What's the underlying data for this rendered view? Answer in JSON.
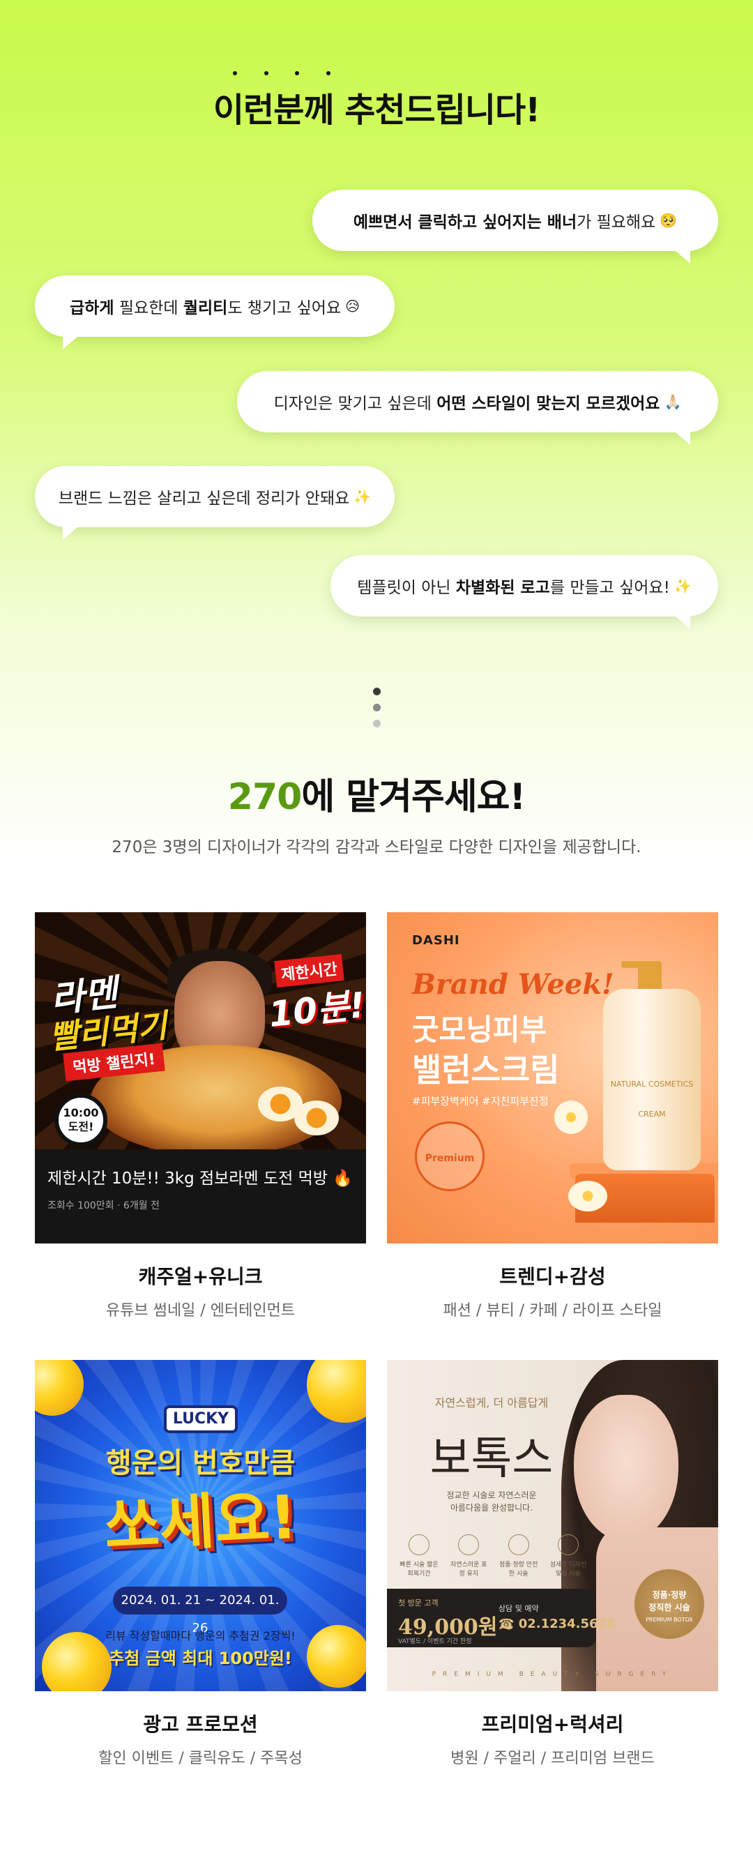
{
  "header": {
    "dots": [
      "•",
      "•",
      "•",
      "•"
    ],
    "title": "이런분께 추천드립니다!"
  },
  "bubbles": [
    {
      "pre": "",
      "bold": "예쁘면서 클릭하고 싶어지는 배너",
      "post": "가 필요해요",
      "emoji": "🥺"
    },
    {
      "pre": "",
      "bold": "급하게",
      "mid": " 필요한데 ",
      "bold2": "퀄리티",
      "post": "도 챙기고 싶어요",
      "emoji": "😥"
    },
    {
      "pre": "디자인은 맞기고 싶은데 ",
      "bold": "어떤 스타일이 맞는지 모르겠어요",
      "post": "",
      "emoji": "🙏🏻"
    },
    {
      "pre": "브랜드 느낌은 살리고 싶은데 정리가 안돼요",
      "bold": "",
      "post": "",
      "emoji": "✨"
    },
    {
      "pre": "템플릿이 아닌 ",
      "bold": "차별화된 로고",
      "post": "를 만들고 싶어요!",
      "emoji": "✨"
    }
  ],
  "section2": {
    "title_accent": "270",
    "title_rest": "에 맡겨주세요!",
    "subtitle": "270은 3명의 디자이너가 각각의 감각과 스타일로 다양한 디자인을 제공합니다."
  },
  "cards": [
    {
      "title": "캐주얼+유니크",
      "desc": "유튜브 썸네일 / 엔터테인먼트",
      "art": {
        "t1": "라멘",
        "t2": "빨리먹기",
        "t3": "먹방 챌린지!",
        "badge_top": "제한시간",
        "badge_big": "10분!",
        "clock": "10:00",
        "clock2": "도전!",
        "caption": "제한시간 10분!! 3kg 점보라멘 도전 먹방 🔥",
        "meta": "조회수 100만회 · 6개월 전"
      }
    },
    {
      "title": "트렌디+감성",
      "desc": "패션 / 뷰티 / 카페 / 라이프 스타일",
      "art": {
        "brand": "DASHI",
        "bw": "Brand Week!",
        "l1": "굿모닝피부",
        "l2": "밸런스크림",
        "tags": "#피부장벽케어 #지친피부진정",
        "seal": "Premium",
        "bottle": "NATURAL COSMETICS",
        "bottle2": "CREAM"
      }
    },
    {
      "title": "광고 프로모션",
      "desc": "할인 이벤트 / 클릭유도 / 주목성",
      "art": {
        "lucky": "LUCKY",
        "t1": "행운의 번호만큼",
        "t2": "쏘세요!",
        "date": "2024. 01. 21 ~ 2024. 01. 26",
        "n1": "리뷰 작성할때마다 행운의 추첨권 2장씩!",
        "n2": "추첨 금액 최대 100만원!"
      }
    },
    {
      "title": "프리미엄+럭셔리",
      "desc": "병원 / 주얼리 / 프리미엄 브랜드",
      "art": {
        "sub": "자연스럽게, 더 아름답게",
        "big": "보톡스",
        "d1": "정교한 시술로 자연스러운",
        "d2": "아름다움을 완성합니다.",
        "icons": [
          "빠른 시술 짧은 회복기간",
          "자연스러운 표정 유지",
          "정품·정량 안전한 시술",
          "섬세한 디자인 맞춤 시술"
        ],
        "pb_l1": "첫 방문 고객",
        "pb_price": "49,000원~",
        "pb_l3": "VAT별도 / 이벤트 기간 한정",
        "pb_r1": "상담 및 예약",
        "pb_phone": "☎ 02.1234.5678",
        "badge1": "정품·정량",
        "badge2": "정직한 시술",
        "badge3": "PREMIUM BOTOX",
        "footer": "PREMIUM BEAUTY SURGERY"
      }
    }
  ],
  "pager": {
    "active_index": 0,
    "count": 3
  }
}
